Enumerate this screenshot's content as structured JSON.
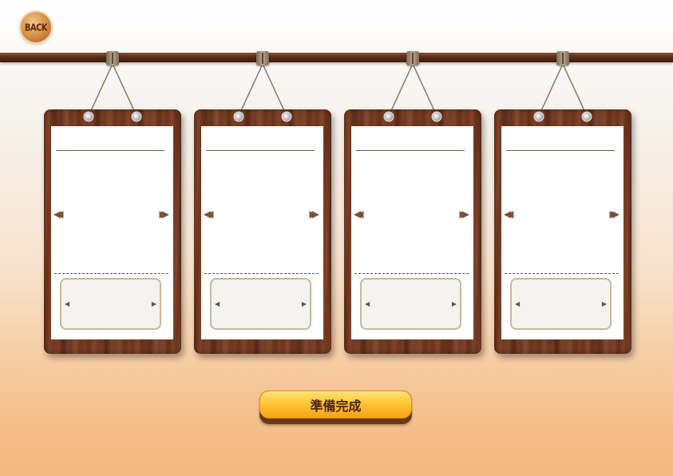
{
  "nav": {
    "back_label": "BACK"
  },
  "boards": [
    {
      "prev_icon": "double-chevron-left-icon",
      "next_icon": "double-chevron-right-icon"
    },
    {
      "prev_icon": "double-chevron-left-icon",
      "next_icon": "double-chevron-right-icon"
    },
    {
      "prev_icon": "double-chevron-left-icon",
      "next_icon": "double-chevron-right-icon"
    },
    {
      "prev_icon": "double-chevron-left-icon",
      "next_icon": "double-chevron-right-icon"
    }
  ],
  "glyphs": {
    "prev": "◀◀",
    "next": "▶▶",
    "slot_prev": "◀",
    "slot_next": "▶"
  },
  "actions": {
    "ready_label": "準備完成"
  },
  "colors": {
    "wood": "#6a3219",
    "button": "#ffc533",
    "rod": "#5a2e16"
  }
}
